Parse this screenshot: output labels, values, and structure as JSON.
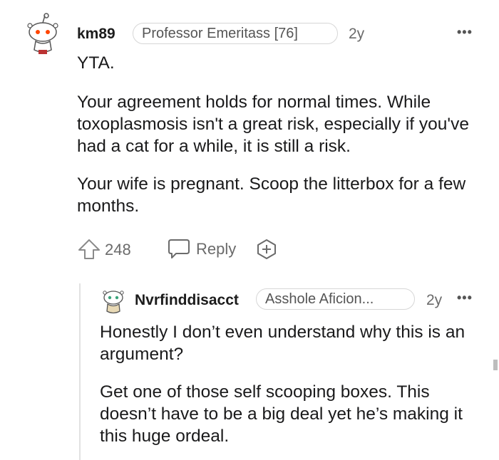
{
  "comment": {
    "avatar_icon": "reddit-snoo-avatar-icon",
    "username": "km89",
    "flair": "Professor Emeritass [76]",
    "age": "2y",
    "more_icon": "more-options-icon",
    "paragraphs": [
      "YTA.",
      "Your agreement holds for normal times. While toxoplasmosis isn't a great risk, especially if you've had a cat for a while, it is still a risk.",
      "Your wife is pregnant. Scoop the litterbox for a few months."
    ],
    "upvote_icon": "upvote-arrow-icon",
    "score": "248",
    "reply_icon": "reply-bubble-icon",
    "reply_label": "Reply",
    "award_icon": "award-plus-icon"
  },
  "reply": {
    "avatar_icon": "reddit-snoo-avatar-icon",
    "username": "Nvrfinddisacct",
    "flair": "Asshole Aficion...",
    "age": "2y",
    "more_icon": "more-options-icon",
    "paragraphs": [
      "Honestly I don’t even understand why this is an argument?",
      "Get one of those self scooping boxes. This doesn’t have to be a big deal yet he’s making it this huge ordeal."
    ]
  },
  "colors": {
    "text": "#1a1a1b",
    "muted": "#6b6b6b",
    "border": "#d6d6d6",
    "avatar_accent": "#ff4500"
  }
}
